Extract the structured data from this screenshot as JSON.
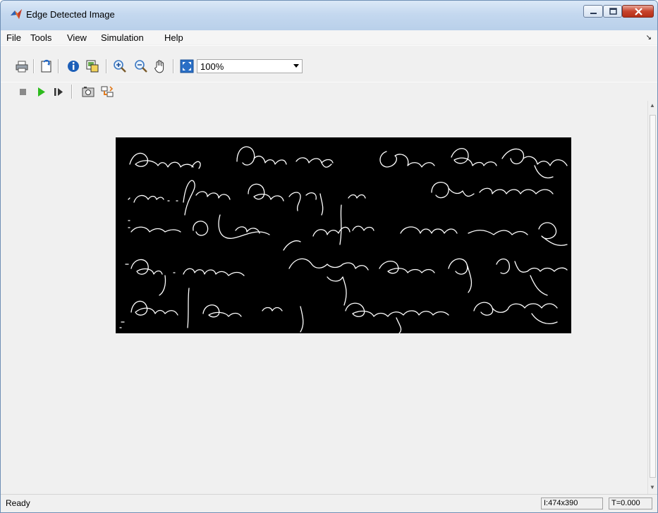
{
  "window": {
    "title": "Edge Detected Image"
  },
  "menu": [
    "File",
    "Tools",
    "View",
    "Simulation",
    "Help"
  ],
  "toolbar": {
    "icons": [
      "print-icon",
      "open-icon",
      "info-icon",
      "export-icon",
      "zoom-in-icon",
      "zoom-out-icon",
      "pan-icon",
      "fit-icon"
    ],
    "zoom_value": "100%"
  },
  "sim_toolbar": {
    "icons": [
      "stop-icon",
      "play-icon",
      "step-icon",
      "snapshot-icon",
      "highlight-icon"
    ]
  },
  "status": {
    "text": "Ready",
    "dimensions": "I:474x390",
    "time": "T=0.000"
  },
  "colors": {
    "play": "#2dbb1d",
    "image_background": "#000000",
    "edge_strokes": "#ffffff"
  }
}
